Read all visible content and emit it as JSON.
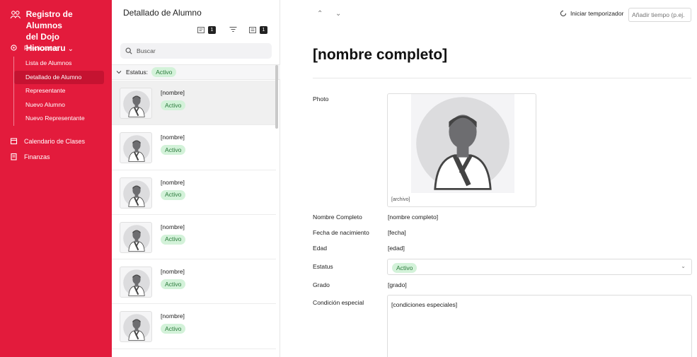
{
  "app": {
    "title_line1": "Registro de Alumnos",
    "title_line2": "del Dojo Hinomaru"
  },
  "sidebar": {
    "section_practicantes": "Practicantes",
    "items": [
      {
        "label": "Lista de Alumnos",
        "active": false
      },
      {
        "label": "Detallado de Alumno",
        "active": true
      },
      {
        "label": "Representante",
        "active": false
      },
      {
        "label": "Nuevo Alumno",
        "active": false
      },
      {
        "label": "Nuevo Representante",
        "active": false
      }
    ],
    "section_calendario": "Calendario de Clases",
    "section_finanzas": "Finanzas"
  },
  "list_panel": {
    "title": "Detallado de Alumno",
    "sort_count": "1",
    "filter_count": "1",
    "search_placeholder": "Buscar",
    "group_label": "Estatus:",
    "group_value": "Activo",
    "rows": [
      {
        "name": "[nombre]",
        "status": "Activo"
      },
      {
        "name": "[nombre]",
        "status": "Activo"
      },
      {
        "name": "[nombre]",
        "status": "Activo"
      },
      {
        "name": "[nombre]",
        "status": "Activo"
      },
      {
        "name": "[nombre]",
        "status": "Activo"
      },
      {
        "name": "[nombre]",
        "status": "Activo"
      }
    ]
  },
  "detail": {
    "timer_label": "Iniciar temporizador",
    "time_placeholder": "Añadir tiempo (p.ej.",
    "record_title": "[nombre completo]",
    "photo_label": "Photo",
    "photo_file": "[archivo]",
    "fields": {
      "nombre_label": "Nombre Completo",
      "nombre_value": "[nombre completo]",
      "fecha_label": "Fecha de nacimiento",
      "fecha_value": "[fecha]",
      "edad_label": "Edad",
      "edad_value": "[edad]",
      "estatus_label": "Estatus",
      "estatus_value": "Activo",
      "grado_label": "Grado",
      "grado_value": "[grado]",
      "condicion_label": "Condición especial",
      "condicion_value": "[condiciones especiales]"
    }
  },
  "colors": {
    "brand": "#e31b3c",
    "status_bg": "#d3f2d9",
    "status_text": "#2a7a3b"
  },
  "icons": {
    "app": "people-icon",
    "practicantes": "cog-icon",
    "calendario": "calendar-icon",
    "finanzas": "document-icon"
  }
}
